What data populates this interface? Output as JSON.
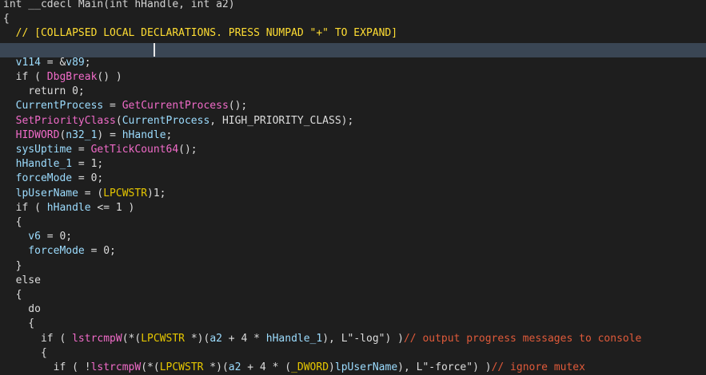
{
  "colors": {
    "background": "#1e1e1e",
    "highlight_line": "#3a4654",
    "keyword": "#d4d4d4",
    "function": "#f06bc8",
    "variable": "#9cdcfe",
    "type": "#e6c700",
    "comment": "#e05a3a",
    "collapsed_comment": "#ffdd33",
    "text": "#dcdcdc"
  },
  "code_lines": [
    [
      [
        "kw",
        "int __cdecl Main(int hHandle, int a2)"
      ]
    ],
    [
      [
        "txt",
        "{"
      ]
    ],
    [
      [
        "cmb",
        "  // [COLLAPSED LOCAL DECLARATIONS. PRESS NUMPAD \"+\" TO EXPAND]"
      ]
    ],
    [],
    [
      [
        "var",
        "  v114"
      ],
      [
        "txt",
        " = &"
      ],
      [
        "var",
        "v89"
      ],
      [
        "txt",
        ";"
      ]
    ],
    [
      [
        "txt",
        "  if ( "
      ],
      [
        "fn",
        "DbgBreak"
      ],
      [
        "txt",
        "() )"
      ]
    ],
    [
      [
        "txt",
        "    return 0;"
      ]
    ],
    [
      [
        "var",
        "  CurrentProcess"
      ],
      [
        "txt",
        " = "
      ],
      [
        "fn",
        "GetCurrentProcess"
      ],
      [
        "txt",
        "();"
      ]
    ],
    [
      [
        "fn",
        "  SetPriorityClass"
      ],
      [
        "txt",
        "("
      ],
      [
        "var",
        "CurrentProcess"
      ],
      [
        "txt",
        ", HIGH_PRIORITY_CLASS);"
      ]
    ],
    [
      [
        "fn",
        "  HIDWORD"
      ],
      [
        "txt",
        "("
      ],
      [
        "var",
        "n32_1"
      ],
      [
        "txt",
        ") = "
      ],
      [
        "var",
        "hHandle"
      ],
      [
        "txt",
        ";"
      ]
    ],
    [
      [
        "var",
        "  sysUptime"
      ],
      [
        "txt",
        " = "
      ],
      [
        "fn",
        "GetTickCount64"
      ],
      [
        "txt",
        "();"
      ]
    ],
    [
      [
        "var",
        "  hHandle_1"
      ],
      [
        "txt",
        " = 1;"
      ]
    ],
    [
      [
        "var",
        "  forceMode"
      ],
      [
        "txt",
        " = 0;"
      ]
    ],
    [
      [
        "var",
        "  lpUserName"
      ],
      [
        "txt",
        " = ("
      ],
      [
        "type",
        "LPCWSTR"
      ],
      [
        "txt",
        ")1;"
      ]
    ],
    [
      [
        "txt",
        "  if ( "
      ],
      [
        "var",
        "hHandle"
      ],
      [
        "txt",
        " <= 1 )"
      ]
    ],
    [
      [
        "txt",
        "  {"
      ]
    ],
    [
      [
        "var",
        "    v6"
      ],
      [
        "txt",
        " = 0;"
      ]
    ],
    [
      [
        "var",
        "    forceMode"
      ],
      [
        "txt",
        " = 0;"
      ]
    ],
    [
      [
        "txt",
        "  }"
      ]
    ],
    [
      [
        "txt",
        "  else"
      ]
    ],
    [
      [
        "txt",
        "  {"
      ]
    ],
    [
      [
        "txt",
        "    do"
      ]
    ],
    [
      [
        "txt",
        "    {"
      ]
    ],
    [
      [
        "txt",
        "      if ( "
      ],
      [
        "fn",
        "lstrcmpW"
      ],
      [
        "txt",
        "(*("
      ],
      [
        "type",
        "LPCWSTR"
      ],
      [
        "txt",
        " *)("
      ],
      [
        "var",
        "a2"
      ],
      [
        "txt",
        " + 4 * "
      ],
      [
        "var",
        "hHandle_1"
      ],
      [
        "txt",
        "), L\"-log\") )"
      ],
      [
        "cm",
        "// output progress messages to console"
      ]
    ],
    [
      [
        "txt",
        "      {"
      ]
    ],
    [
      [
        "txt",
        "        if ( !"
      ],
      [
        "fn",
        "lstrcmpW"
      ],
      [
        "txt",
        "(*("
      ],
      [
        "type",
        "LPCWSTR"
      ],
      [
        "txt",
        " *)("
      ],
      [
        "var",
        "a2"
      ],
      [
        "txt",
        " + 4 * ("
      ],
      [
        "type",
        "_DWORD"
      ],
      [
        "txt",
        ")"
      ],
      [
        "var",
        "lpUserName"
      ],
      [
        "txt",
        "), L\"-force\") )"
      ],
      [
        "cm",
        "// ignore mutex"
      ]
    ],
    [
      [
        "txt",
        "        {"
      ]
    ]
  ],
  "highlighted_line": 3,
  "caret_line": 3,
  "caret_col": 24
}
